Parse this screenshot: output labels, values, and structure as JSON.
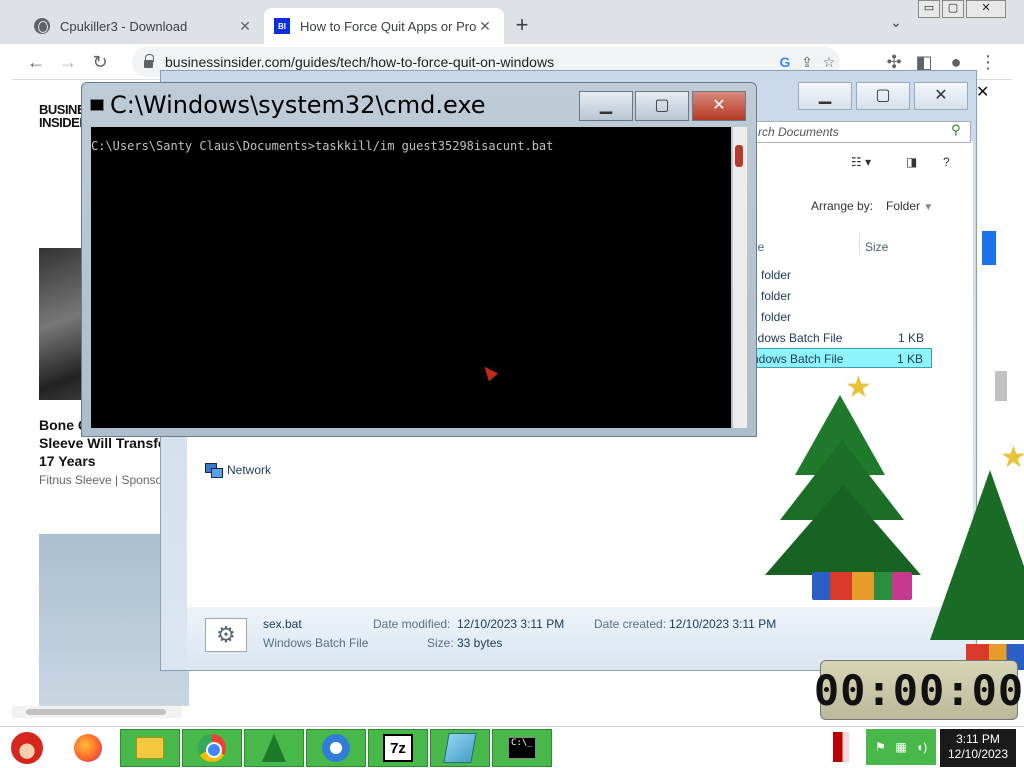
{
  "browser": {
    "tabs": [
      {
        "title": "Cpukiller3 - Download",
        "active": false,
        "icon": "globe-icon"
      },
      {
        "title": "How to Force Quit Apps or Progr",
        "active": true,
        "icon": "bi-favicon",
        "favicon_text": "BI"
      }
    ],
    "url": "businessinsider.com/guides/tech/how-to-force-quit-on-windows",
    "page": {
      "logo": "BUSINESS\nINSIDER",
      "ad_headline": "Bone C\nSleeve Will Transfo\n17 Years",
      "ad_sponsor": "Fitnus Sleeve | Sponsor"
    }
  },
  "explorer": {
    "search_placeholder": "rch Documents",
    "arrange_by_label": "Arrange by:",
    "arrange_by_value": "Folder",
    "columns": {
      "type": "pe",
      "size": "Size"
    },
    "rows": [
      {
        "type": "e folder",
        "size": "",
        "selected": false
      },
      {
        "type": "e folder",
        "size": "",
        "selected": false
      },
      {
        "type": "e folder",
        "size": "",
        "selected": false
      },
      {
        "type": "ndows Batch File",
        "size": "1 KB",
        "selected": false
      },
      {
        "type": "ndows Batch File",
        "size": "1 KB",
        "selected": true
      }
    ],
    "nav": {
      "network": "Network"
    },
    "details": {
      "file_name": "sex.bat",
      "file_type": "Windows Batch File",
      "date_modified_label": "Date modified:",
      "date_modified": "12/10/2023 3:11 PM",
      "date_created_label": "Date created:",
      "date_created": "12/10/2023 3:11 PM",
      "size_label": "Size:",
      "size": "33 bytes"
    }
  },
  "cmd": {
    "title": "C:\\Windows\\system32\\cmd.exe",
    "command_line": "C:\\Users\\Santy Claus\\Documents>taskkill/im guest35298isacunt.bat"
  },
  "timer": {
    "display": "00:00:00"
  },
  "taskbar": {
    "apps": [
      "santa-start-icon",
      "firefox-icon",
      "file-explorer-icon",
      "chrome-icon",
      "christmas-tree-icon",
      "shield-icon",
      "7zip-icon",
      "notepad-icon",
      "cmd-icon"
    ],
    "zip_label": "7z",
    "clock_time": "3:11 PM",
    "clock_date": "12/10/2023"
  },
  "colors": {
    "taskbar_green": "#48b84a",
    "selection": "#8ef4fb",
    "chrome_tabstrip": "#dee1e6"
  }
}
